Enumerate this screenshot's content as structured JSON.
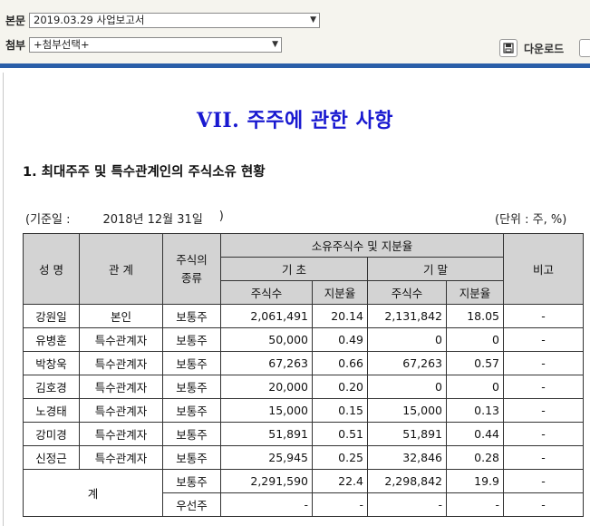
{
  "toolbar": {
    "main_label": "본문",
    "main_value": "2019.03.29 사업보고서",
    "attach_label": "첨부",
    "attach_value": "+첨부선택+",
    "download_label": "다운로드"
  },
  "document": {
    "title": "VII. 주주에 관한 사항",
    "section": "1. 최대주주 및 특수관계인의 주식소유 현황",
    "base_date_label": "(기준일 :",
    "base_date_value": "2018년 12월 31일",
    "base_date_close": ")",
    "unit": "(단위 : 주, %)"
  },
  "table": {
    "headers": {
      "name": "성 명",
      "relation": "관 계",
      "stock_type": "주식의\n종류",
      "owned": "소유주식수 및 지분율",
      "begin": "기 초",
      "end": "기 말",
      "shares": "주식수",
      "ratio": "지분율",
      "remark": "비고"
    },
    "rows": [
      {
        "name": "강원일",
        "relation": "본인",
        "type": "보통주",
        "begin_shares": "2,061,491",
        "begin_ratio": "20.14",
        "end_shares": "2,131,842",
        "end_ratio": "18.05",
        "remark": "-"
      },
      {
        "name": "유병훈",
        "relation": "특수관계자",
        "type": "보통주",
        "begin_shares": "50,000",
        "begin_ratio": "0.49",
        "end_shares": "0",
        "end_ratio": "0",
        "remark": "-"
      },
      {
        "name": "박창욱",
        "relation": "특수관계자",
        "type": "보통주",
        "begin_shares": "67,263",
        "begin_ratio": "0.66",
        "end_shares": "67,263",
        "end_ratio": "0.57",
        "remark": "-"
      },
      {
        "name": "김호경",
        "relation": "특수관계자",
        "type": "보통주",
        "begin_shares": "20,000",
        "begin_ratio": "0.20",
        "end_shares": "0",
        "end_ratio": "0",
        "remark": "-"
      },
      {
        "name": "노경태",
        "relation": "특수관계자",
        "type": "보통주",
        "begin_shares": "15,000",
        "begin_ratio": "0.15",
        "end_shares": "15,000",
        "end_ratio": "0.13",
        "remark": "-"
      },
      {
        "name": "강미경",
        "relation": "특수관계자",
        "type": "보통주",
        "begin_shares": "51,891",
        "begin_ratio": "0.51",
        "end_shares": "51,891",
        "end_ratio": "0.44",
        "remark": "-"
      },
      {
        "name": "신정근",
        "relation": "특수관계자",
        "type": "보통주",
        "begin_shares": "25,945",
        "begin_ratio": "0.25",
        "end_shares": "32,846",
        "end_ratio": "0.28",
        "remark": "-"
      }
    ],
    "total": {
      "label": "계",
      "common": {
        "type": "보통주",
        "begin_shares": "2,291,590",
        "begin_ratio": "22.4",
        "end_shares": "2,298,842",
        "end_ratio": "19.9",
        "remark": "-"
      },
      "preferred": {
        "type": "우선주",
        "begin_shares": "-",
        "begin_ratio": "-",
        "end_shares": "-",
        "end_ratio": "-",
        "remark": "-"
      }
    }
  }
}
